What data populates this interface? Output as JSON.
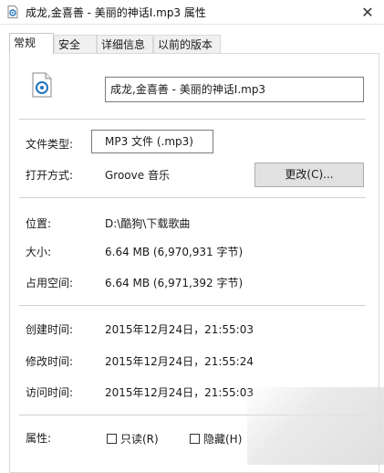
{
  "window": {
    "title": "成龙,金喜善 - 美丽的神话Ⅰ.mp3 属性",
    "close_glyph": "✕"
  },
  "tabs": [
    {
      "label": "常规",
      "active": true
    },
    {
      "label": "安全",
      "active": false
    },
    {
      "label": "详细信息",
      "active": false
    },
    {
      "label": "以前的版本",
      "active": false
    }
  ],
  "general": {
    "file_name": "成龙,金喜善 - 美丽的神话Ⅰ.mp3",
    "type_label": "文件类型:",
    "type_value": "MP3 文件 (.mp3)",
    "opens_with_label": "打开方式:",
    "opens_with_value": "Groove 音乐",
    "change_button": "更改(C)...",
    "location_label": "位置:",
    "location_value": "D:\\酷狗\\下载歌曲",
    "size_label": "大小:",
    "size_value": "6.64 MB (6,970,931 字节)",
    "size_on_disk_label": "占用空间:",
    "size_on_disk_value": "6.64 MB (6,971,392 字节)",
    "created_label": "创建时间:",
    "created_value": "2015年12月24日，21:55:03",
    "modified_label": "修改时间:",
    "modified_value": "2015年12月24日，21:55:24",
    "accessed_label": "访问时间:",
    "accessed_value": "2015年12月24日，21:55:03",
    "attributes_label": "属性:",
    "readonly_label": "只读(R)",
    "hidden_label": "隐藏(H)"
  },
  "colors": {
    "accent": "#1e73be",
    "button_bg": "#e1e1e1"
  },
  "icons": {
    "title": "music-file-icon",
    "file": "mp3-file-icon",
    "close": "close-icon"
  }
}
